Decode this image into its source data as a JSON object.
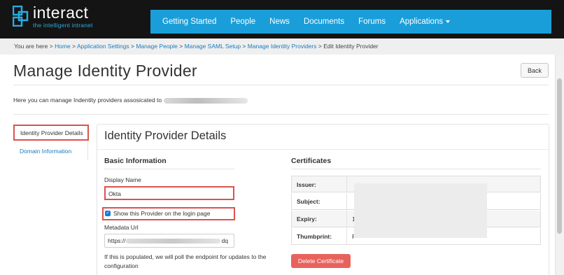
{
  "header": {
    "brand": "interact",
    "tagline": "the intelligent intranet",
    "nav": [
      "Getting Started",
      "People",
      "News",
      "Documents",
      "Forums",
      "Applications"
    ]
  },
  "breadcrumb": {
    "prefix": "You are here >",
    "links": [
      "Home",
      "Application Settings",
      "Manage People",
      "Manage SAML Setup",
      "Manage Identity Providers"
    ],
    "current": "Edit Identity Provider"
  },
  "page": {
    "title": "Manage Identity Provider",
    "back_label": "Back",
    "intro": "Here you can manage Indentity providers assosicated to"
  },
  "sidebar": {
    "items": [
      "Identity Provider Details",
      "Domain Information"
    ]
  },
  "panel": {
    "title": "Identity Provider Details",
    "basic": {
      "heading": "Basic Information",
      "display_name_label": "Display Name",
      "display_name_value": "Okta",
      "show_on_login_label": "Show this Provider on the login page",
      "show_on_login_checked": true,
      "metadata_label": "Metadata Url",
      "metadata_prefix": "https://",
      "metadata_suffix": "dq",
      "help_text": "If this is populated, we will poll the endpoint for updates to the configuration"
    },
    "certificates": {
      "heading": "Certificates",
      "rows": [
        {
          "key": "Issuer:",
          "value": ""
        },
        {
          "key": "Subject:",
          "value": ""
        },
        {
          "key": "Expiry:",
          "value": "1"
        },
        {
          "key": "Thumbprint:",
          "value": "F"
        }
      ],
      "delete_label": "Delete Certificate"
    }
  },
  "colors": {
    "nav_bg": "#1a9ed9",
    "topbar_bg": "#141414",
    "link": "#1a7bbf",
    "highlight": "#d9534f",
    "delete": "#e8625c"
  }
}
